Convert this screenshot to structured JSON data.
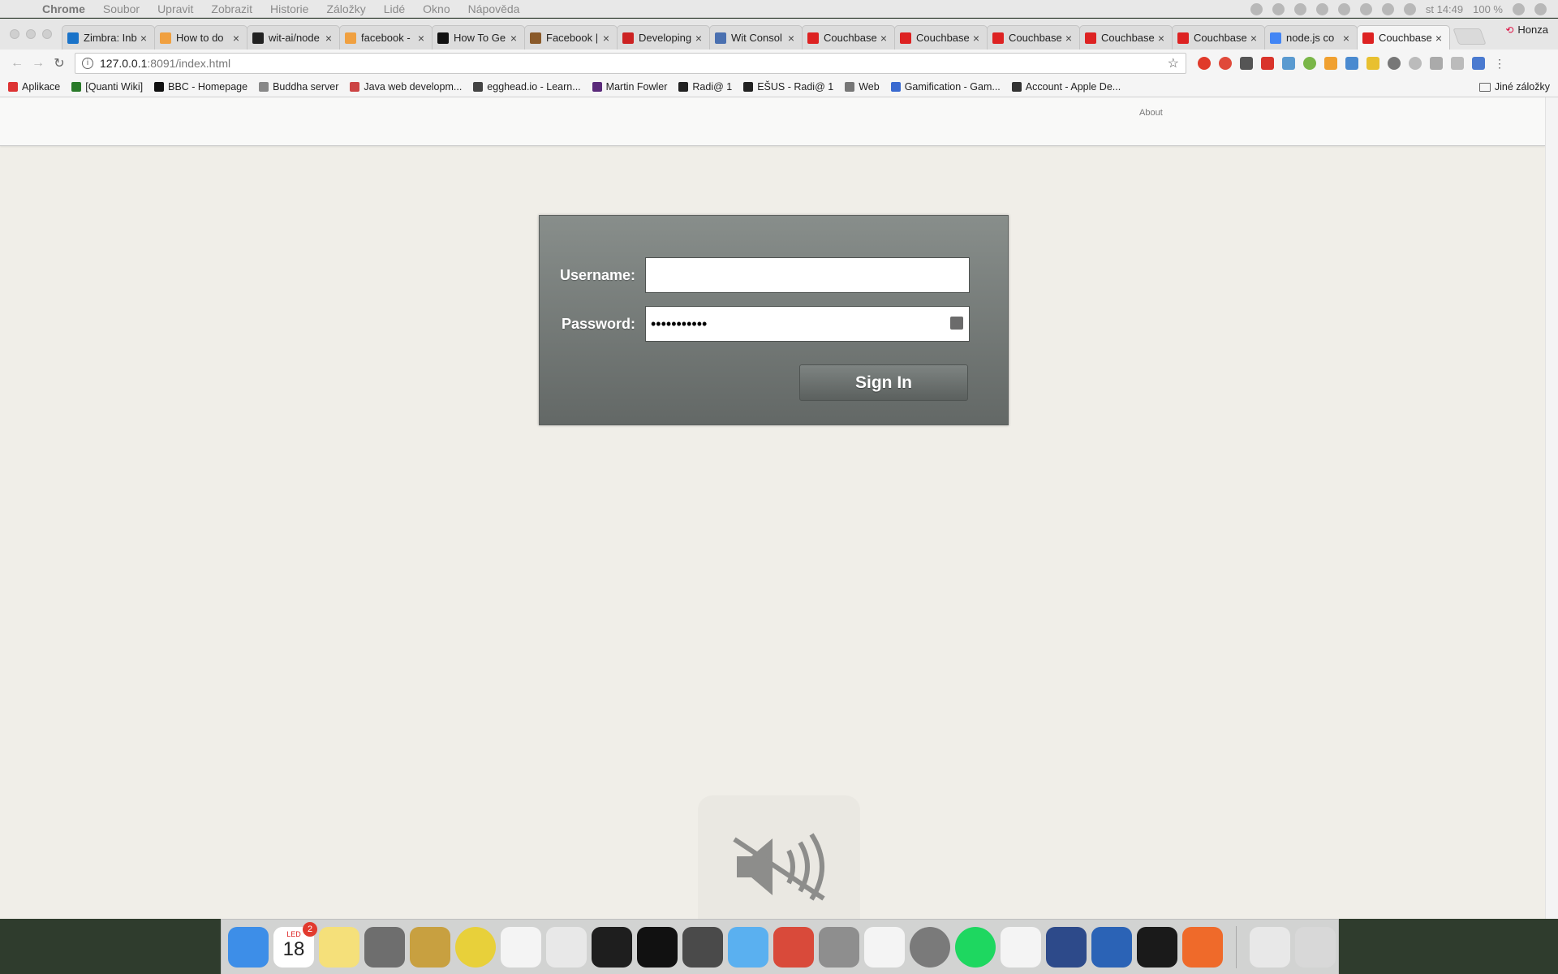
{
  "menubar": {
    "app_name": "Chrome",
    "items": [
      "Soubor",
      "Upravit",
      "Zobrazit",
      "Historie",
      "Záložky",
      "Lidé",
      "Okno",
      "Nápověda"
    ],
    "clock": "st 14:49",
    "battery": "100 %"
  },
  "tabs": [
    {
      "title": "Zimbra: Inb",
      "color": "#1a73c9"
    },
    {
      "title": "How to do",
      "color": "#f0a040"
    },
    {
      "title": "wit-ai/node",
      "color": "#222222"
    },
    {
      "title": "facebook -",
      "color": "#f0a040"
    },
    {
      "title": "How To Ge",
      "color": "#111111"
    },
    {
      "title": "Facebook |",
      "color": "#8a5a2a"
    },
    {
      "title": "Developing",
      "color": "#cc2222"
    },
    {
      "title": "Wit Consol",
      "color": "#4a70b0"
    },
    {
      "title": "Couchbase",
      "color": "#dd2222"
    },
    {
      "title": "Couchbase",
      "color": "#dd2222"
    },
    {
      "title": "Couchbase",
      "color": "#dd2222"
    },
    {
      "title": "Couchbase",
      "color": "#dd2222"
    },
    {
      "title": "Couchbase",
      "color": "#dd2222"
    },
    {
      "title": "node.js co",
      "color": "#4285f4"
    },
    {
      "title": "Couchbase",
      "color": "#dd2222",
      "active": true
    }
  ],
  "profile": {
    "name": "Honza"
  },
  "toolbar": {
    "url_host": "127.0.0.1",
    "url_path": ":8091/index.html"
  },
  "bookmarks": [
    {
      "label": "Aplikace",
      "color": "#d33"
    },
    {
      "label": "[Quanti Wiki]",
      "color": "#2a7a2a"
    },
    {
      "label": "BBC - Homepage",
      "color": "#111111"
    },
    {
      "label": "Buddha server",
      "color": "#888888"
    },
    {
      "label": "Java web developm...",
      "color": "#c44"
    },
    {
      "label": "egghead.io - Learn...",
      "color": "#444444"
    },
    {
      "label": "Martin Fowler",
      "color": "#5a2a7a"
    },
    {
      "label": "Radi@ 1",
      "color": "#222222"
    },
    {
      "label": "EŠUS - Radi@ 1",
      "color": "#222222"
    },
    {
      "label": "Web",
      "color": "#777777"
    },
    {
      "label": "Gamification - Gam...",
      "color": "#3a6ad0"
    },
    {
      "label": "Account - Apple De...",
      "color": "#333333"
    }
  ],
  "bookmarks_other": "Jiné záložky",
  "page": {
    "about_link": "About",
    "login": {
      "username_label": "Username:",
      "username_value": "",
      "password_label": "Password:",
      "password_value": "•••••••••••",
      "sign_in_label": "Sign In"
    }
  },
  "dock": {
    "calendar_month": "LED",
    "calendar_day": "18",
    "calendar_badge": "2",
    "apps": [
      {
        "name": "finder",
        "color": "#3d8ee8"
      },
      {
        "name": "calendar",
        "color": "#ffffff"
      },
      {
        "name": "notes",
        "color": "#f5e07a"
      },
      {
        "name": "system-preferences",
        "color": "#6e6e6e"
      },
      {
        "name": "transmit",
        "color": "#c8a040"
      },
      {
        "name": "chrome",
        "color": "#e8d03a"
      },
      {
        "name": "photos",
        "color": "#f4f4f4"
      },
      {
        "name": "launchpad",
        "color": "#e8e8e8"
      },
      {
        "name": "terminal",
        "color": "#1e1e1e"
      },
      {
        "name": "intellij",
        "color": "#111111"
      },
      {
        "name": "sublime-text",
        "color": "#4a4a4a"
      },
      {
        "name": "messages",
        "color": "#5ab0f0"
      },
      {
        "name": "wunderlist",
        "color": "#d94a3a"
      },
      {
        "name": "preferences",
        "color": "#8e8e8e"
      },
      {
        "name": "picasa",
        "color": "#f4f4f4"
      },
      {
        "name": "power",
        "color": "#7a7a7a"
      },
      {
        "name": "spotify",
        "color": "#1ed760"
      },
      {
        "name": "slack",
        "color": "#f4f4f4"
      },
      {
        "name": "code-editor",
        "color": "#2d4a8a"
      },
      {
        "name": "word",
        "color": "#2b63b6"
      },
      {
        "name": "webstorm",
        "color": "#1a1a1a"
      },
      {
        "name": "postman",
        "color": "#ef6a2a"
      }
    ],
    "extra": [
      {
        "name": "zip-archive",
        "color": "#e8e8e8"
      },
      {
        "name": "trash",
        "color": "#d8d8d8"
      }
    ]
  }
}
